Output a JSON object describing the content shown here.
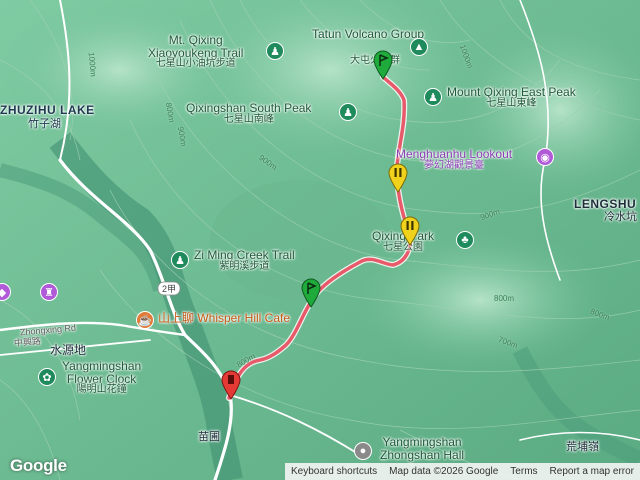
{
  "map": {
    "colors": {
      "terrain": "#6fbf97",
      "terrain_light": "#9fd6b6",
      "terrain_dark": "#4e9f78",
      "valley": "#2f7e68",
      "road": "#ffffff",
      "track": "#e8596a",
      "marker_start": "#1faa3c",
      "marker_waypoint": "#f0d21c",
      "marker_end": "#e53935"
    }
  },
  "places": {
    "xiaoyoukeng": {
      "en1": "Mt. Qixing",
      "en2": "Xiaoyoukeng Trail",
      "zh": "七星山小油坑步道",
      "icon": "hiker-icon"
    },
    "tatun": {
      "en": "Tatun Volcano Group",
      "zh": "大屯火山群",
      "icon": "mountain-icon"
    },
    "east_peak": {
      "en": "Mount Qixing East Peak",
      "zh": "七星山東峰",
      "icon": "hiker-icon"
    },
    "south_peak": {
      "en": "Qixingshan South Peak",
      "zh": "七星山南峰",
      "icon": "hiker-icon"
    },
    "zhuzihu": {
      "en": "ZHUZIHU LAKE",
      "zh": "竹子湖"
    },
    "menghuanhu": {
      "en": "Menghuanhu Lookout",
      "zh": "夢幻湖觀景臺",
      "icon": "camera-icon"
    },
    "lengshui": {
      "en": "LENGSHU",
      "zh": "冷水坑"
    },
    "qixing_park": {
      "en": "Qixing Park",
      "zh": "七星公園",
      "icon": "tree-icon"
    },
    "ziming": {
      "en": "Zi Ming Creek Trail",
      "zh": "紫明溪步道",
      "icon": "hiker-icon"
    },
    "whisper": {
      "en": "山上聊 Whisper Hill Cafe",
      "icon": "coffee-icon"
    },
    "flower_clock": {
      "en1": "Yangmingshan",
      "en2": "Flower Clock",
      "zh": "陽明山花鐘",
      "icon": "flower-icon"
    },
    "zhongxing": {
      "en": "Zhongxing Rd",
      "zh": "中興路",
      "extra": "水源地"
    },
    "miaopu": {
      "zh": "苗圃"
    },
    "zhongshan_hall": {
      "en1": "Yangmingshan",
      "en2": "Zhongshan Hall",
      "icon": "landmark-icon"
    },
    "huangpuling": {
      "zh": "荒埔嶺"
    },
    "road_2jia": {
      "text": "2甲"
    }
  },
  "contours": [
    "1000m",
    "1000m",
    "900m",
    "900m",
    "900m",
    "800m",
    "800m",
    "800m",
    "800m",
    "700m"
  ],
  "footer": {
    "logo": "Google",
    "shortcuts": "Keyboard shortcuts",
    "map_data": "Map data ©2026 Google",
    "terms": "Terms",
    "report": "Report a map error"
  }
}
